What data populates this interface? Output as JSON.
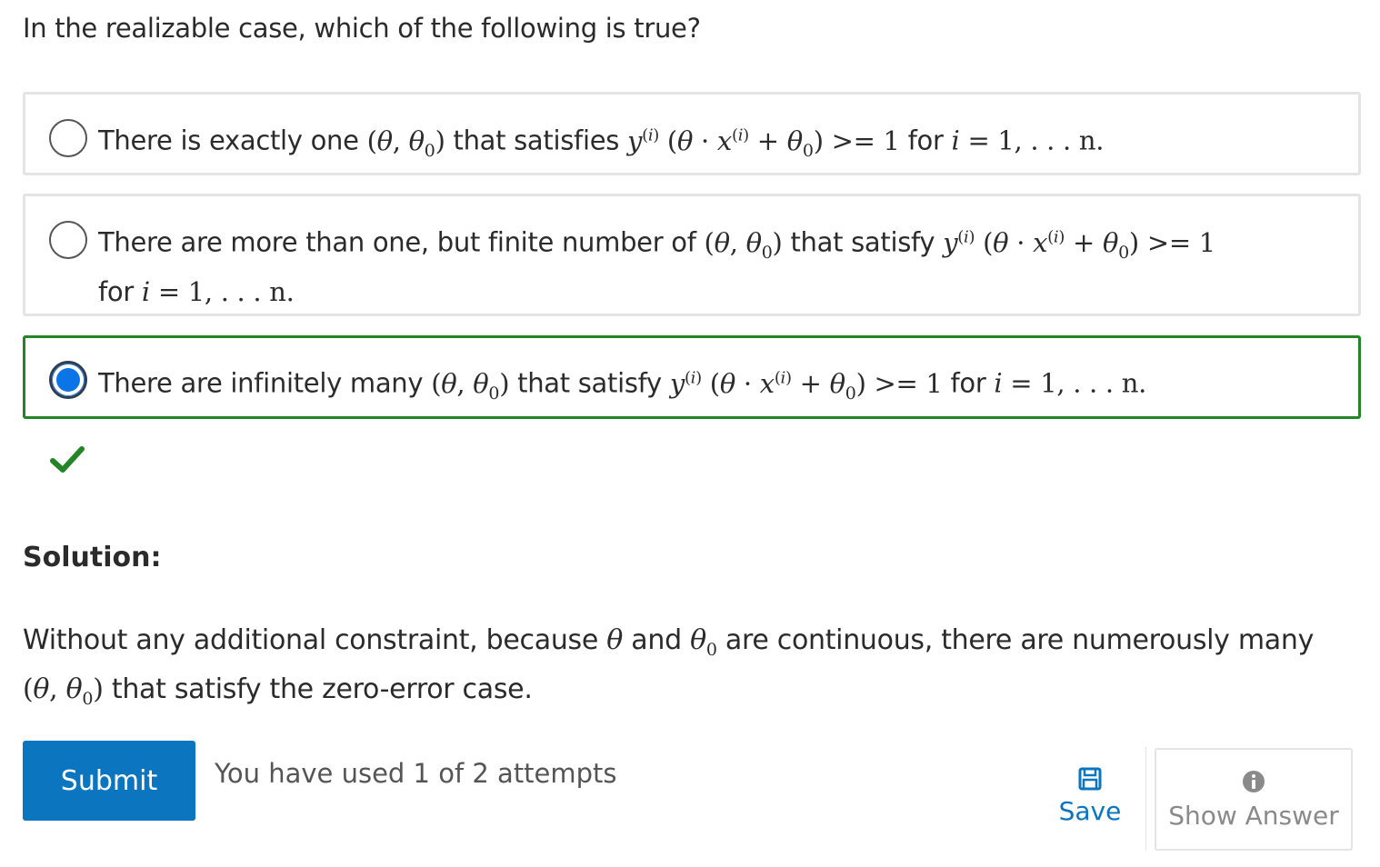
{
  "question": "In the realizable case, which of the following is true?",
  "options": [
    {
      "prefix": "There is exactly one",
      "mid": "that satisfies",
      "suffix": "for",
      "end": "= 1, . . . n.",
      "selected": false
    },
    {
      "prefix": "There are more than one, but finite number of",
      "mid": "that satisfy",
      "suffix": "for",
      "end": "= 1, . . . n.",
      "selected": false
    },
    {
      "prefix": "There are infinitely many",
      "mid": "that satisfy",
      "suffix": "for",
      "end": "= 1, . . . n.",
      "selected": true
    }
  ],
  "status": {
    "correct": true,
    "color": "#248527"
  },
  "solution": {
    "label": "Solution:",
    "part1": "Without any additional constraint, because",
    "and": "and",
    "part2": "are continuous, there are numerously many",
    "part3": "that satisfy the zero-error case."
  },
  "actions": {
    "submit_label": "Submit",
    "attempts_text": "You have used 1 of 2 attempts",
    "save_label": "Save",
    "show_answer_label": "Show Answer"
  },
  "colors": {
    "accent": "#0b75c0",
    "selected_radio": "#0b75e8",
    "correct_border": "#248527"
  },
  "icons": {
    "check": "check-icon",
    "save": "save-icon",
    "info": "info-icon"
  }
}
